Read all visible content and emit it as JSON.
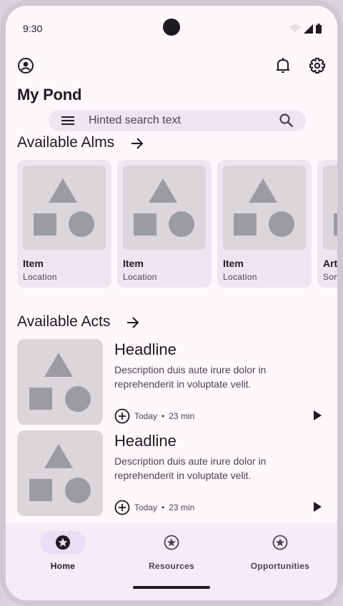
{
  "status_bar": {
    "time": "9:30",
    "icons": [
      "wifi-icon",
      "signal-icon",
      "battery-icon"
    ]
  },
  "top_bar": {
    "left_icon": "account-circle-icon",
    "right_icons": [
      "notifications-icon",
      "settings-icon"
    ]
  },
  "page_title": "My Pond",
  "search": {
    "placeholder": "Hinted search text",
    "leading_icon": "menu-icon",
    "trailing_icon": "search-icon"
  },
  "sections": {
    "alms": {
      "title": "Available Alms",
      "action_icon": "arrow-right-icon"
    },
    "acts": {
      "title": "Available Acts",
      "action_icon": "arrow-right-icon"
    }
  },
  "alms_cards": [
    {
      "title": "Item",
      "subtitle": "Location"
    },
    {
      "title": "Item",
      "subtitle": "Location"
    },
    {
      "title": "Item",
      "subtitle": "Location"
    },
    {
      "title": "Art",
      "subtitle": "Son"
    }
  ],
  "acts_list": [
    {
      "headline": "Headline",
      "description": "Description duis aute irure dolor in reprehenderit in voluptate velit.",
      "date": "Today",
      "separator": "•",
      "duration": "23 min"
    },
    {
      "headline": "Headline",
      "description": "Description duis aute irure dolor in reprehenderit in voluptate velit.",
      "date": "Today",
      "separator": "•",
      "duration": "23 min"
    }
  ],
  "bottom_nav": [
    {
      "label": "Home",
      "icon": "star-circle-icon",
      "active": true
    },
    {
      "label": "Resources",
      "icon": "star-circle-icon",
      "active": false
    },
    {
      "label": "Opportunities",
      "icon": "star-circle-icon",
      "active": false
    }
  ],
  "colors": {
    "background": "#fef7fc",
    "surface_container": "#ece6f0",
    "nav_background": "#f3edf7",
    "active_indicator": "#e8def8",
    "placeholder_fill": "#dad6da",
    "placeholder_shape": "#9a9ca1",
    "on_surface": "#1d1b20",
    "on_surface_variant": "#49454f"
  }
}
